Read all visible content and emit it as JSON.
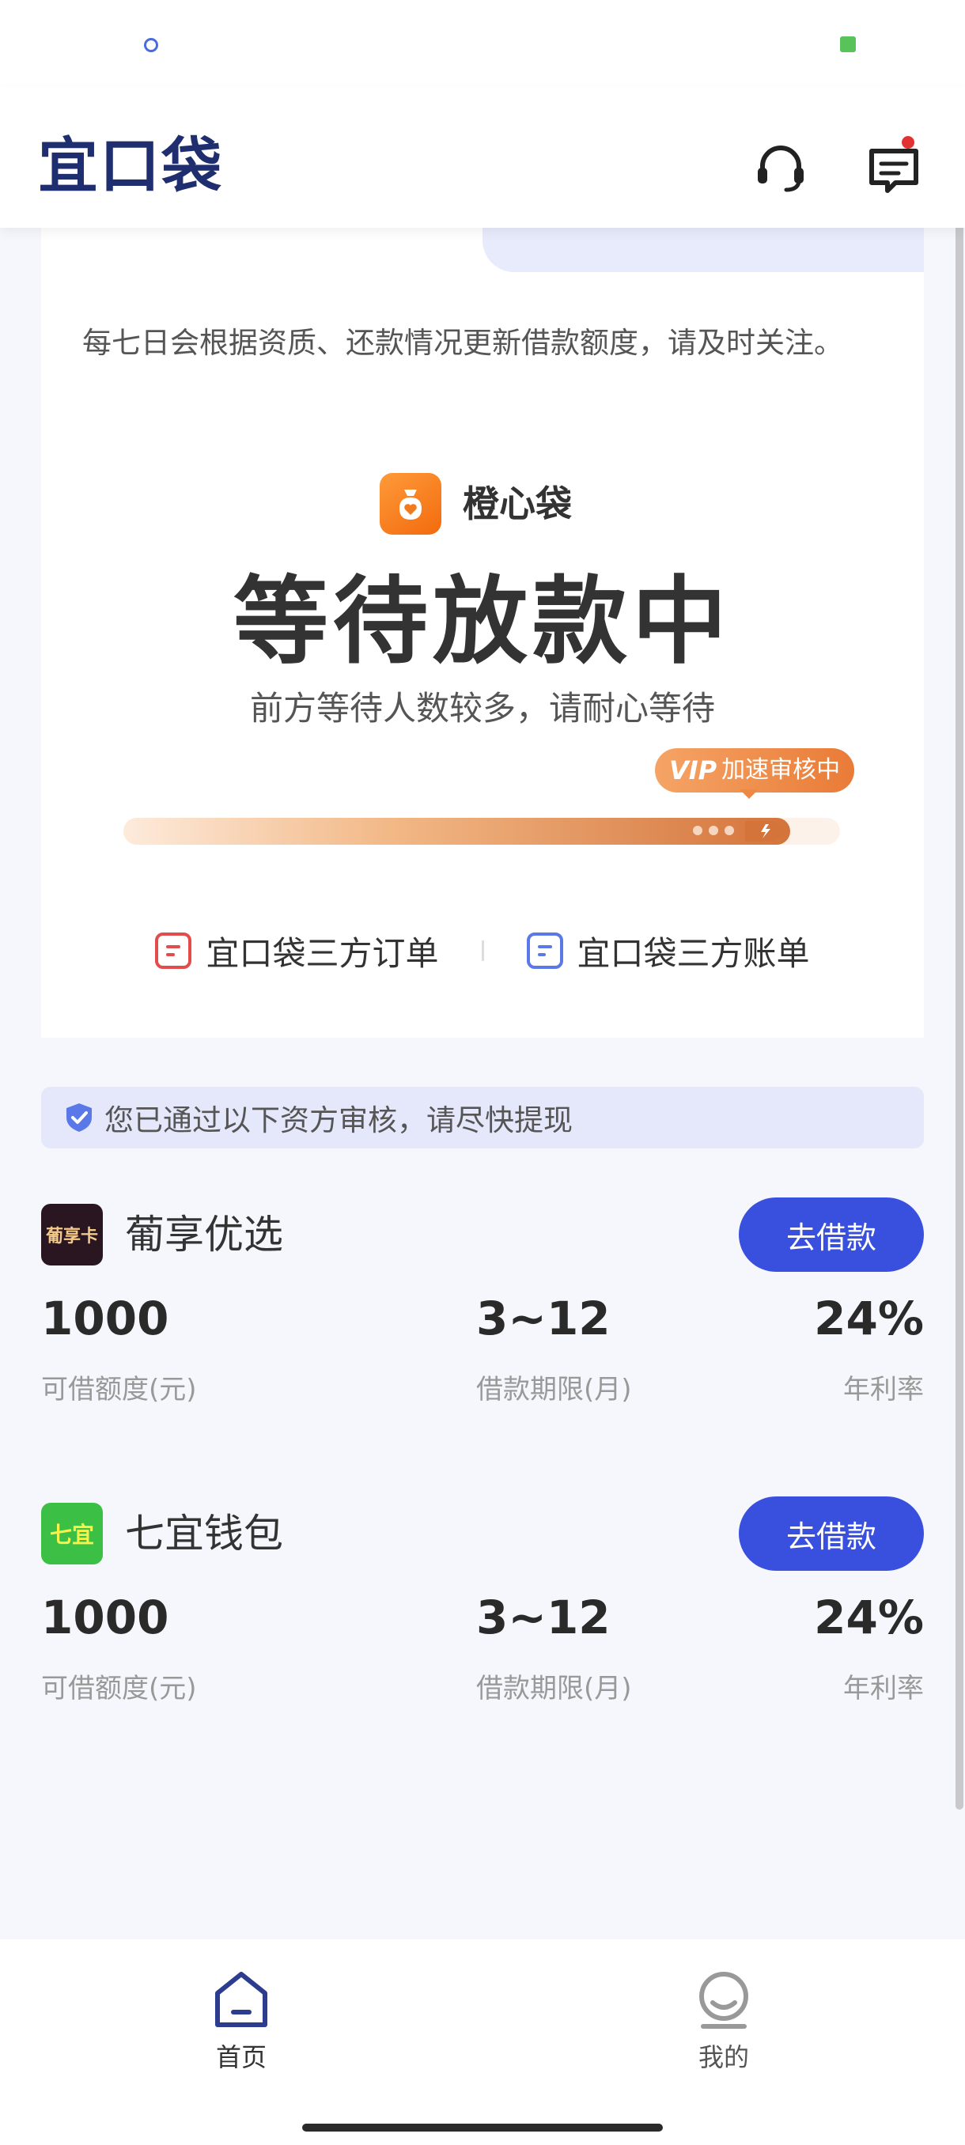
{
  "app": {
    "logo_text": "宜口袋"
  },
  "header": {
    "support_icon": "headset-icon",
    "message_icon": "message-icon"
  },
  "status_card": {
    "notice": "每七日会根据资质、还款情况更新借款额度，请及时关注。",
    "lender_name": "橙心袋",
    "status_title": "等待放款中",
    "status_subtitle": "前方等待人数较多，请耐心等待",
    "vip_label": "VIP",
    "vip_status": "加速审核中",
    "progress_percent": 93,
    "links": [
      {
        "label": "宜口袋三方订单",
        "icon": "order-doc-icon",
        "color": "#e34c4c"
      },
      {
        "label": "宜口袋三方账单",
        "icon": "bill-doc-icon",
        "color": "#5a78e8"
      }
    ]
  },
  "approved_banner": {
    "text": "您已通过以下资方审核，请尽快提现"
  },
  "offers": [
    {
      "logo_text": "葡享卡",
      "name": "葡享优选",
      "button": "去借款",
      "amount": "1000",
      "amount_label": "可借额度(元)",
      "term": "3~12",
      "term_label": "借款期限(月)",
      "rate": "24%",
      "rate_label": "年利率"
    },
    {
      "logo_text": "七宜",
      "name": "七宜钱包",
      "button": "去借款",
      "amount": "1000",
      "amount_label": "可借额度(元)",
      "term": "3~12",
      "term_label": "借款期限(月)",
      "rate": "24%",
      "rate_label": "年利率"
    }
  ],
  "bottom_nav": [
    {
      "label": "首页",
      "icon": "home-icon",
      "active": true
    },
    {
      "label": "我的",
      "icon": "profile-icon",
      "active": false
    }
  ],
  "colors": {
    "primary": "#3950de",
    "brand_navy": "#1f2e6f",
    "accent_orange": "#e97b37"
  }
}
